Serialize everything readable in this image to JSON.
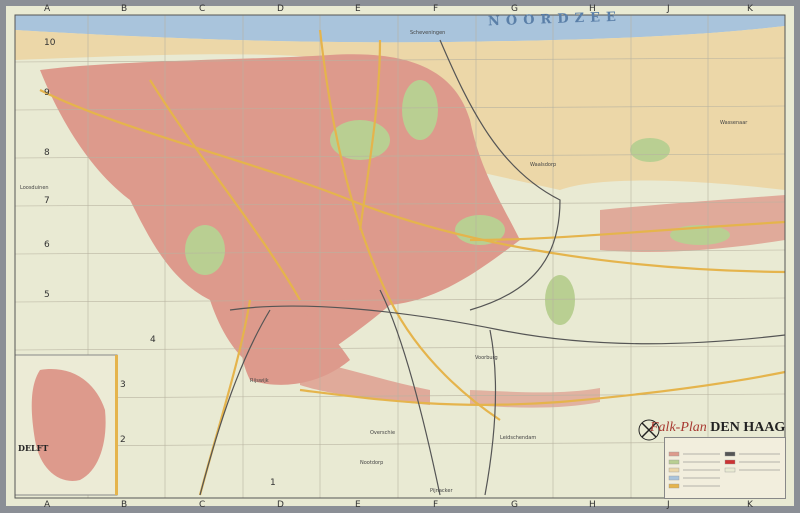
{
  "map": {
    "title_script": "Falk-Plan",
    "title_city": "DEN HAAG",
    "sea_label": "NOORDZEE",
    "inset_label": "DELFT",
    "columns": [
      "A",
      "B",
      "C",
      "D",
      "E",
      "F",
      "G",
      "H",
      "J",
      "K"
    ],
    "row_labels": [
      "10",
      "9",
      "8",
      "7",
      "6",
      "5",
      "4",
      "3",
      "2",
      "1"
    ],
    "places": [
      "Scheveningen",
      "Wassenaar",
      "Loosduinen",
      "Rijswijk",
      "Voorburg",
      "Leidschendam",
      "Nootdorp",
      "Waalsdorp",
      "Overschie",
      "Pijnacker"
    ],
    "colors": {
      "sea": "#a9c4dc",
      "dunes": "#ecd7a8",
      "land": "#e9ead3",
      "city": "#dd9a8c",
      "park": "#b9cf92",
      "road": "#e5b44c",
      "rail": "#555555",
      "grid": "#b8b3a0"
    },
    "icons": [
      "compass-icon"
    ]
  }
}
